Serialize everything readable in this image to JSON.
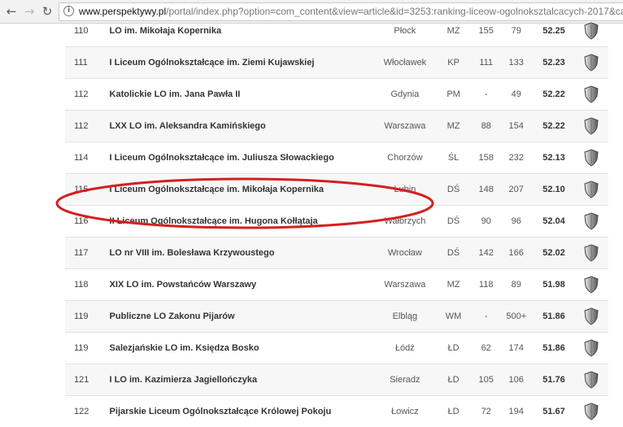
{
  "browser": {
    "back_icon": "arrow-left-icon",
    "forward_icon": "arrow-right-icon",
    "reload_icon": "reload-icon",
    "info_icon": "info-icon",
    "url_domain": "www.perspektywy.pl",
    "url_path": "/portal/index.php?option=com_content&view=article&id=3253:ranking-liceow-ogolnoksztalcacych-2017&cati"
  },
  "table": {
    "shield_icon": "shield-icon",
    "rows": [
      {
        "rank": "110",
        "name": "LO im. Mikołaja Kopernika",
        "city": "Płock",
        "woj": "MZ",
        "a": "155",
        "b": "79",
        "score": "52.25"
      },
      {
        "rank": "111",
        "name": "I Liceum Ogólnokształcące im. Ziemi Kujawskiej",
        "city": "Włocławek",
        "woj": "KP",
        "a": "111",
        "b": "133",
        "score": "52.23"
      },
      {
        "rank": "112",
        "name": "Katolickie LO im. Jana Pawła II",
        "city": "Gdynia",
        "woj": "PM",
        "a": "-",
        "b": "49",
        "score": "52.22"
      },
      {
        "rank": "112",
        "name": "LXX LO im. Aleksandra Kamińskiego",
        "city": "Warszawa",
        "woj": "MZ",
        "a": "88",
        "b": "154",
        "score": "52.22"
      },
      {
        "rank": "114",
        "name": "I Liceum Ogólnokształcące im. Juliusza Słowackiego",
        "city": "Chorzów",
        "woj": "ŚL",
        "a": "158",
        "b": "232",
        "score": "52.13"
      },
      {
        "rank": "115",
        "name": "I Liceum Ogólnokształcące im. Mikołaja Kopernika",
        "city": "Lubin",
        "woj": "DŚ",
        "a": "148",
        "b": "207",
        "score": "52.10"
      },
      {
        "rank": "116",
        "name": "II Liceum Ogólnokształcące im. Hugona Kołłątaja",
        "city": "Wałbrzych",
        "woj": "DŚ",
        "a": "90",
        "b": "96",
        "score": "52.04"
      },
      {
        "rank": "117",
        "name": "LO nr VIII im. Bolesława Krzywoustego",
        "city": "Wrocław",
        "woj": "DŚ",
        "a": "142",
        "b": "166",
        "score": "52.02"
      },
      {
        "rank": "118",
        "name": "XIX LO im. Powstańców Warszawy",
        "city": "Warszawa",
        "woj": "MZ",
        "a": "118",
        "b": "89",
        "score": "51.98"
      },
      {
        "rank": "119",
        "name": "Publiczne LO Zakonu Pijarów",
        "city": "Elbląg",
        "woj": "WM",
        "a": "-",
        "b": "500+",
        "score": "51.86"
      },
      {
        "rank": "119",
        "name": "Salezjańskie LO im. Księdza Bosko",
        "city": "Łódź",
        "woj": "ŁD",
        "a": "62",
        "b": "174",
        "score": "51.86"
      },
      {
        "rank": "121",
        "name": "I LO im. Kazimierza Jagiellończyka",
        "city": "Sieradz",
        "woj": "ŁD",
        "a": "105",
        "b": "106",
        "score": "51.76"
      },
      {
        "rank": "122",
        "name": "Pijarskie Liceum Ogólnokształcące Królowej Pokoju",
        "city": "Łowicz",
        "woj": "ŁD",
        "a": "72",
        "b": "194",
        "score": "51.67"
      }
    ]
  },
  "annotation_color": "#d42020"
}
